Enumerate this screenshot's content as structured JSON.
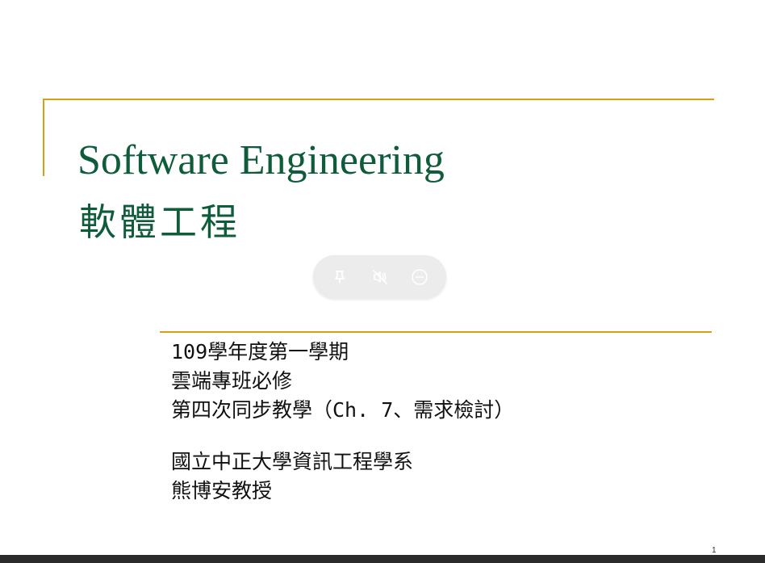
{
  "slide": {
    "title": "Software Engineering",
    "title_zh": "軟體工程",
    "subtitle_lines": [
      "109學年度第一學期",
      "雲端專班必修",
      "第四次同步教學（Ch. 7、需求檢討）"
    ],
    "author_lines": [
      "國立中正大學資訊工程學系",
      "熊博安教授"
    ],
    "page_number": "1"
  },
  "toolbar": {
    "buttons": [
      {
        "icon": "pin-icon"
      },
      {
        "icon": "mute-icon"
      },
      {
        "icon": "minimize-icon"
      }
    ]
  },
  "colors": {
    "title": "#0f5c3a",
    "accent": "#d4a017",
    "text": "#111111",
    "toolbar_bg": "#ececec",
    "toolbar_icon": "#ffffff",
    "bottom_bar": "#2b2b2b"
  }
}
